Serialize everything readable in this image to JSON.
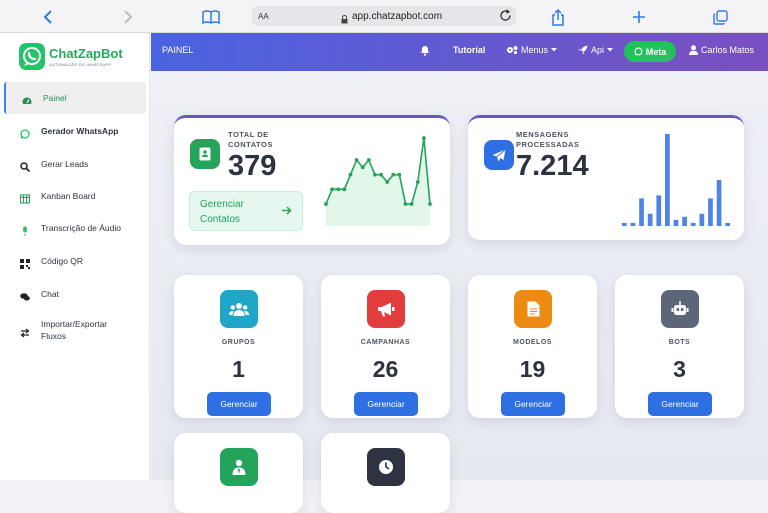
{
  "browser": {
    "text_size_label": "AA",
    "url": "app.chatzapbot.com"
  },
  "brand": {
    "name": "ChatZapBot",
    "tagline": "AUTOMAÇÃO DO WHATSAPP"
  },
  "sidebar": {
    "items": [
      {
        "label": "Painel",
        "icon": "gauge-icon",
        "active": true
      },
      {
        "label": "Gerador WhatsApp",
        "icon": "whatsapp-icon",
        "bold": true
      },
      {
        "label": "Gerar Leads",
        "icon": "search-icon"
      },
      {
        "label": "Kanban Board",
        "icon": "kanban-icon"
      },
      {
        "label": "Transcrição de Áudio",
        "icon": "microphone-icon"
      },
      {
        "label": "Código QR",
        "icon": "qrcode-icon"
      },
      {
        "label": "Chat",
        "icon": "chat-icon"
      },
      {
        "label": "Importar/Exportar Fluxos",
        "icon": "exchange-icon"
      }
    ]
  },
  "topbar": {
    "title": "PAINEL",
    "tutorial": "Tutorial",
    "menus": "Menus",
    "api": "Api",
    "meta": "Meta",
    "user": "Carlos Matos"
  },
  "stats": {
    "contacts": {
      "label_line1": "TOTAL DE",
      "label_line2": "CONTATOS",
      "value": "379",
      "button_line1": "Gerenciar",
      "button_line2": "Contatos",
      "color": "#23a45a"
    },
    "messages": {
      "label_line1": "MENSAGENS",
      "label_line2": "PROCESSADAS",
      "value": "7.214",
      "color": "#2f6fe4"
    }
  },
  "sparkline_contacts": [
    3,
    5,
    5,
    5,
    7,
    9,
    8,
    9,
    7,
    7,
    6,
    7,
    7,
    3,
    3,
    6,
    12,
    3
  ],
  "sparkbars_messages": [
    1,
    1,
    9,
    4,
    10,
    30,
    2,
    3,
    1,
    4,
    9,
    15,
    1
  ],
  "tiles": [
    {
      "label": "GRUPOS",
      "value": "1",
      "button": "Gerenciar",
      "icon": "users-icon",
      "color": "#1fa6c9"
    },
    {
      "label": "CAMPANHAS",
      "value": "26",
      "button": "Gerenciar",
      "icon": "megaphone-icon",
      "color": "#e23d3d"
    },
    {
      "label": "MODELOS",
      "value": "19",
      "button": "Gerenciar",
      "icon": "document-icon",
      "color": "#ec8a12"
    },
    {
      "label": "BOTS",
      "value": "3",
      "button": "Gerenciar",
      "icon": "robot-icon",
      "color": "#5d6678"
    }
  ],
  "tiles_row2": [
    {
      "icon": "user-tie-icon",
      "color": "#23a45a"
    },
    {
      "icon": "clock-icon",
      "color": "#2d3340"
    }
  ]
}
